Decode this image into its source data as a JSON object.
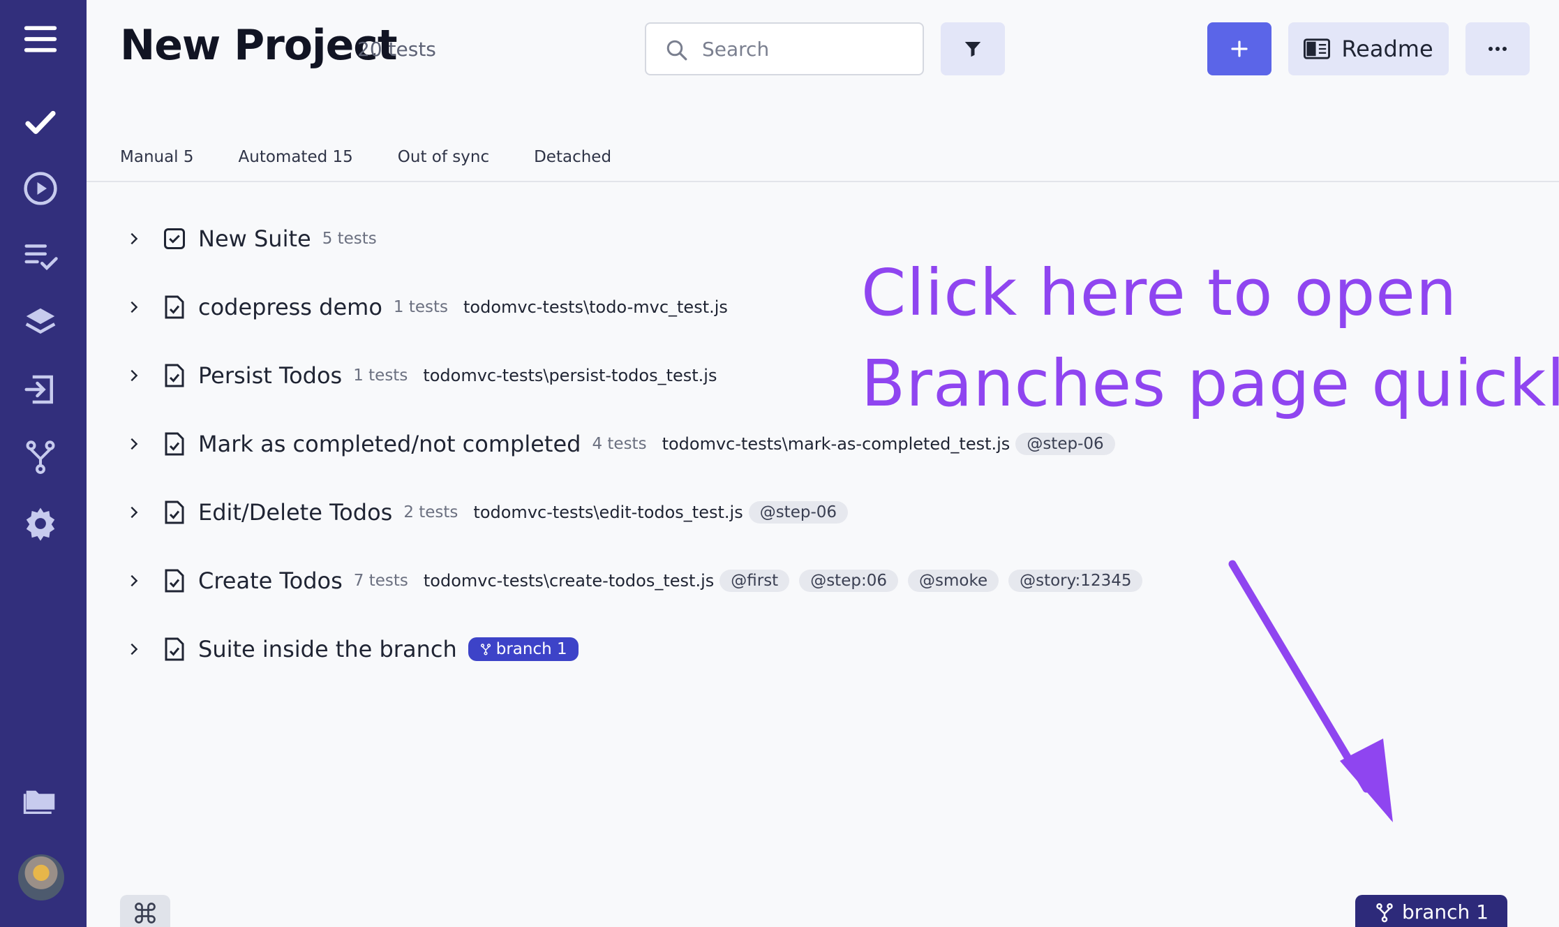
{
  "project": {
    "title": "New Project",
    "count": "20 tests"
  },
  "search": {
    "placeholder": "Search",
    "value": ""
  },
  "toolbar": {
    "add_label": "+",
    "readme_label": "Readme",
    "more_label": "···"
  },
  "tabs": [
    {
      "label": "Manual 5"
    },
    {
      "label": "Automated 15"
    },
    {
      "label": "Out of sync"
    },
    {
      "label": "Detached"
    }
  ],
  "suites": [
    {
      "name": "New Suite",
      "count": "5 tests",
      "path": "",
      "tags": []
    },
    {
      "name": "codepress demo",
      "count": "1 tests",
      "path": "todomvc-tests\\todo-mvc_test.js",
      "tags": []
    },
    {
      "name": "Persist Todos",
      "count": "1 tests",
      "path": "todomvc-tests\\persist-todos_test.js",
      "tags": []
    },
    {
      "name": "Mark as completed/not completed",
      "count": "4 tests",
      "path": "todomvc-tests\\mark-as-completed_test.js",
      "tags": [
        "@step-06"
      ]
    },
    {
      "name": "Edit/Delete Todos",
      "count": "2 tests",
      "path": "todomvc-tests\\edit-todos_test.js",
      "tags": [
        "@step-06"
      ]
    },
    {
      "name": "Create Todos",
      "count": "7 tests",
      "path": "todomvc-tests\\create-todos_test.js",
      "tags": [
        "@first",
        "@step:06",
        "@smoke",
        "@story:12345"
      ]
    },
    {
      "name": "Suite inside the branch",
      "count": "",
      "path": "",
      "tags": [],
      "branch": "branch 1"
    }
  ],
  "annotation": {
    "line1": "Click here to open",
    "line2": "Branches page quickly"
  },
  "footer": {
    "branch_label": "branch 1"
  },
  "colors": {
    "sidebar": "#322f7c",
    "accent": "#5b65e8",
    "annotation": "#8f45f0",
    "branch_badge": "#3d43c8"
  }
}
